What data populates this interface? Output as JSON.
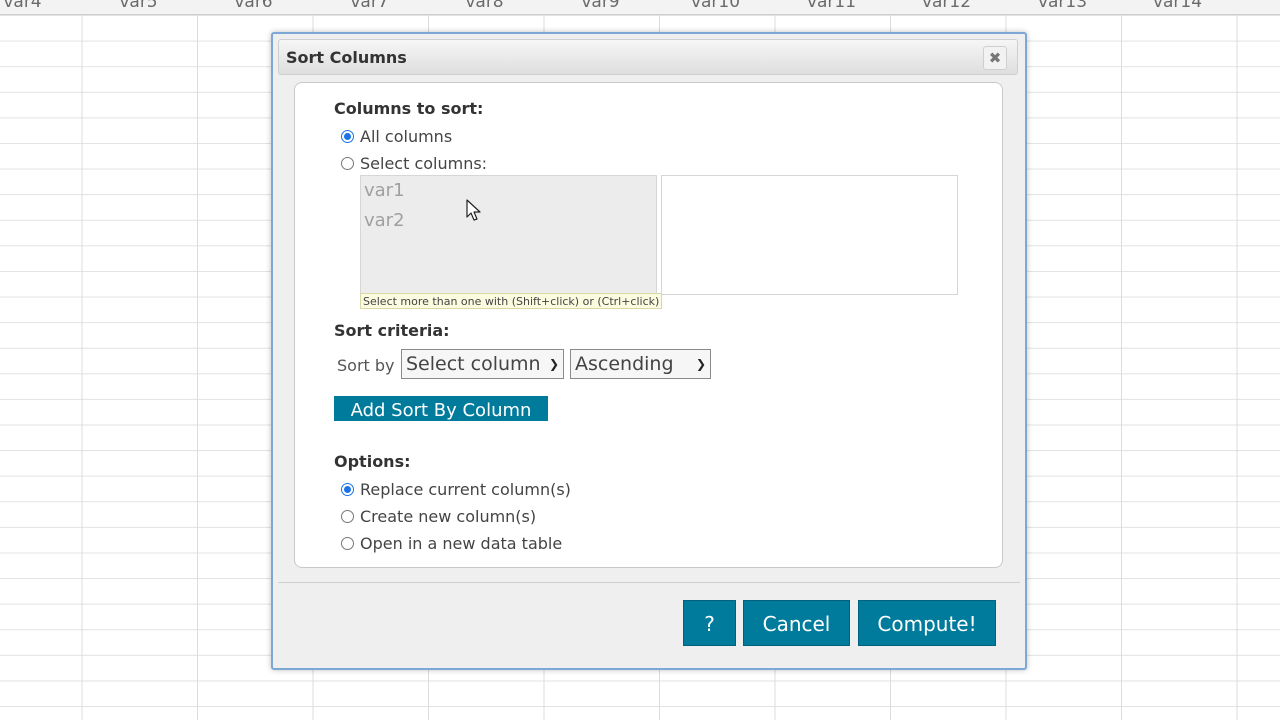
{
  "spreadsheet": {
    "columns": [
      "var4",
      "var5",
      "var6",
      "var7",
      "var8",
      "var9",
      "var10",
      "var11",
      "var12",
      "var13",
      "var14"
    ]
  },
  "dialog": {
    "title": "Sort Columns",
    "close_glyph": "✖",
    "columns_to_sort_label": "Columns to sort:",
    "radio_all_columns": "All columns",
    "radio_select_columns": "Select columns:",
    "available_columns": [
      "var1",
      "var2"
    ],
    "selection_hint": "Select more than one with (Shift+click) or (Ctrl+click)",
    "sort_criteria_label": "Sort criteria:",
    "sort_by_label": "Sort by",
    "column_select_value": "Select column",
    "order_select_value": "Ascending",
    "add_sort_button": "Add Sort By Column",
    "options_label": "Options:",
    "option_replace": "Replace current column(s)",
    "option_create": "Create new column(s)",
    "option_new_table": "Open in a new data table",
    "help_button": "?",
    "cancel_button": "Cancel",
    "compute_button": "Compute!"
  },
  "colors": {
    "accent": "#007b9c",
    "radio_selected": "#1a73e8",
    "dialog_border": "#7da8d6"
  }
}
